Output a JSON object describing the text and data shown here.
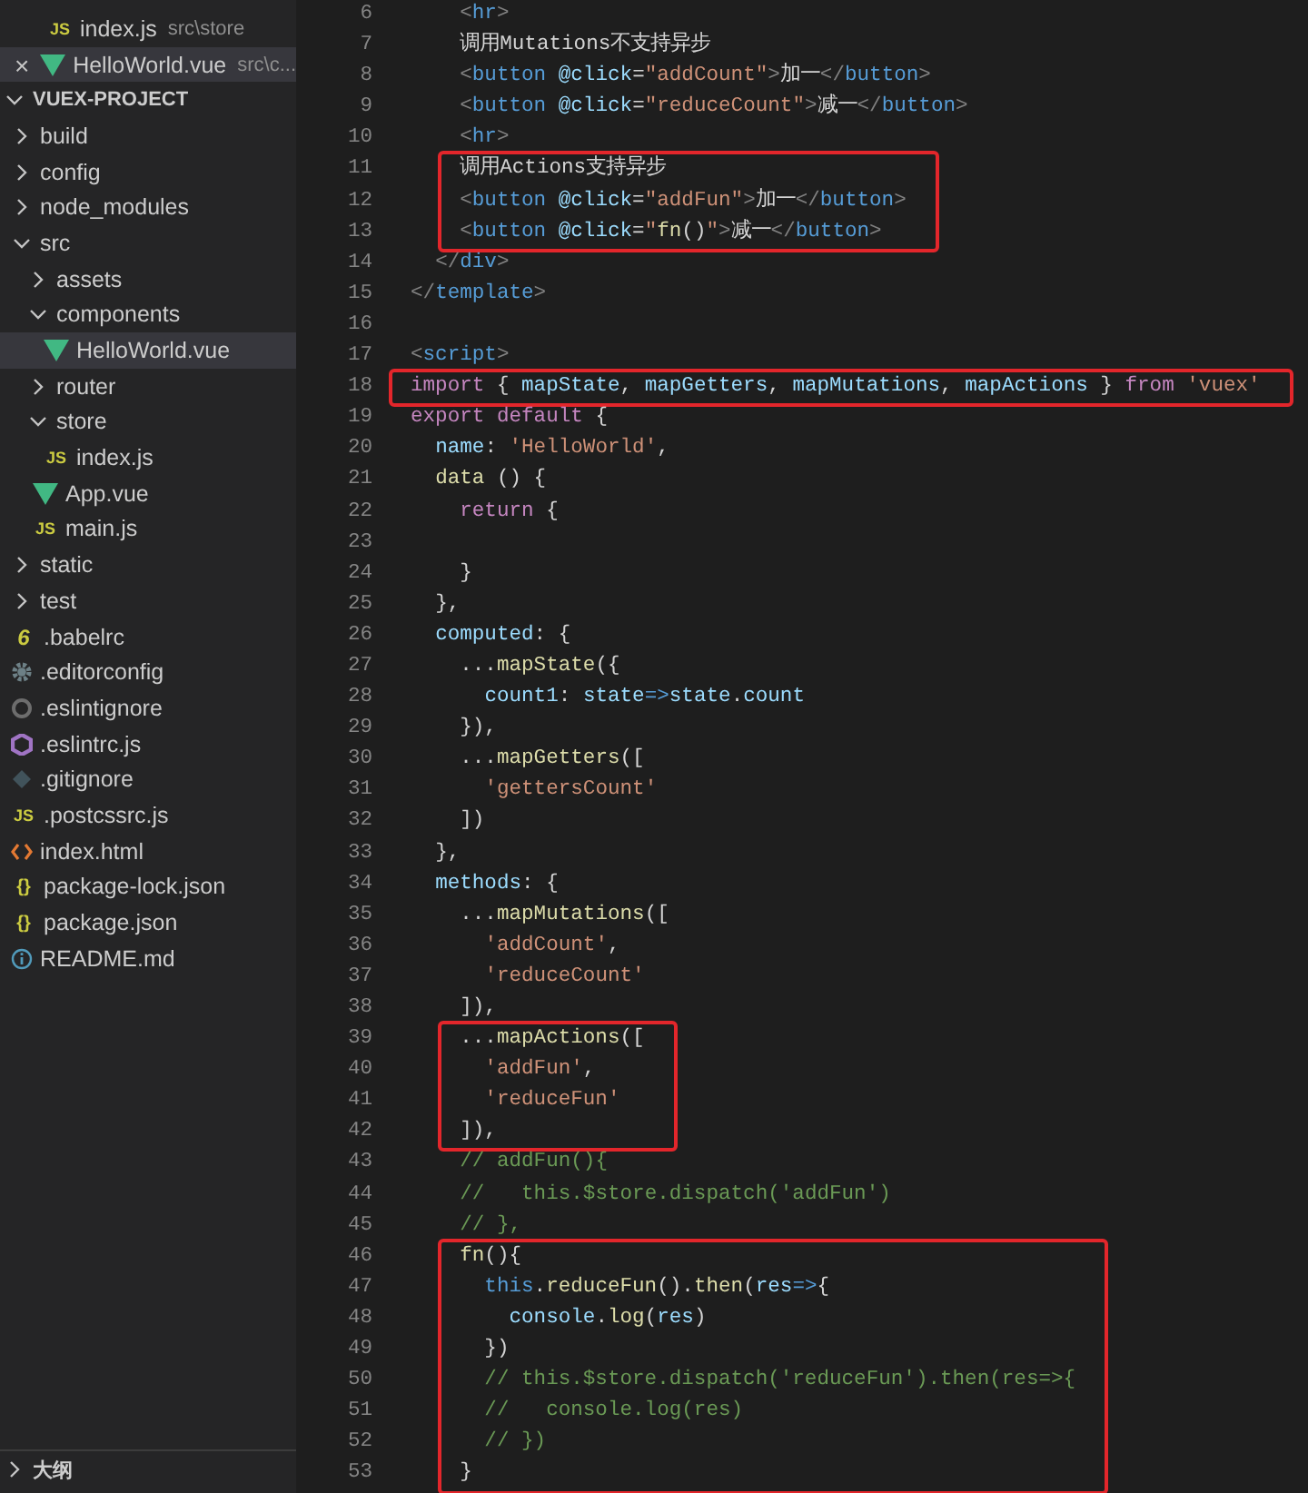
{
  "sidebar": {
    "open_editors": [
      {
        "name": "index.js",
        "path": "src\\store",
        "kind": "js",
        "badge": "JS",
        "selected": false,
        "closable": false
      },
      {
        "name": "HelloWorld.vue",
        "path": "src\\c...",
        "kind": "vue",
        "selected": true,
        "closable": true,
        "close_glyph": "×"
      }
    ],
    "project": {
      "title": "VUEX-PROJECT",
      "expanded": true
    },
    "tree": [
      {
        "kind": "folder",
        "name": "build",
        "expanded": false,
        "selected": false
      },
      {
        "kind": "folder",
        "name": "config",
        "expanded": false,
        "selected": false
      },
      {
        "kind": "folder",
        "name": "node_modules",
        "expanded": false,
        "selected": false
      },
      {
        "kind": "folder",
        "name": "src",
        "expanded": true,
        "selected": false,
        "children": [
          {
            "kind": "folder",
            "name": "assets",
            "expanded": false,
            "selected": false
          },
          {
            "kind": "folder",
            "name": "components",
            "expanded": true,
            "selected": false,
            "children": [
              {
                "kind": "vue",
                "name": "HelloWorld.vue",
                "selected": true
              }
            ]
          },
          {
            "kind": "folder",
            "name": "router",
            "expanded": false,
            "selected": false
          },
          {
            "kind": "folder",
            "name": "store",
            "expanded": true,
            "selected": false,
            "children": [
              {
                "kind": "js",
                "name": "index.js",
                "badge": "JS",
                "selected": false
              }
            ]
          },
          {
            "kind": "vue",
            "name": "App.vue",
            "selected": false
          },
          {
            "kind": "js",
            "name": "main.js",
            "badge": "JS",
            "selected": false
          }
        ]
      },
      {
        "kind": "folder",
        "name": "static",
        "expanded": false,
        "selected": false
      },
      {
        "kind": "folder",
        "name": "test",
        "expanded": false,
        "selected": false
      },
      {
        "kind": "babel",
        "name": ".babelrc",
        "badge": "6",
        "selected": false
      },
      {
        "kind": "gear",
        "name": ".editorconfig",
        "selected": false
      },
      {
        "kind": "ring",
        "name": ".eslintignore",
        "selected": false
      },
      {
        "kind": "hexagon",
        "name": ".eslintrc.js",
        "selected": false
      },
      {
        "kind": "diamond",
        "name": ".gitignore",
        "selected": false
      },
      {
        "kind": "js",
        "name": ".postcssrc.js",
        "badge": "JS",
        "selected": false
      },
      {
        "kind": "html",
        "name": "index.html",
        "selected": false
      },
      {
        "kind": "json",
        "name": "package-lock.json",
        "badge": "{}",
        "selected": false
      },
      {
        "kind": "json",
        "name": "package.json",
        "badge": "{}",
        "selected": false
      },
      {
        "kind": "info",
        "name": "README.md",
        "selected": false
      }
    ],
    "outline": {
      "title": "大纲",
      "expanded": false
    }
  },
  "editor": {
    "blocks": [
      {
        "boxed": false,
        "lines": [
          {
            "n": "6",
            "tokens": [
              {
                "kind": "p",
                "text": "    <"
              },
              {
                "kind": "tag",
                "text": "hr"
              },
              {
                "kind": "p",
                "text": ">"
              }
            ]
          },
          {
            "n": "7",
            "tokens": [
              {
                "kind": "txt",
                "text": "    调用Mutations不支持异步"
              }
            ]
          },
          {
            "n": "8",
            "tokens": [
              {
                "kind": "p",
                "text": "    <"
              },
              {
                "kind": "tag",
                "text": "button"
              },
              {
                "kind": "attr",
                "text": " @click"
              },
              {
                "kind": "txt",
                "text": "="
              },
              {
                "kind": "str",
                "text": "\"addCount\""
              },
              {
                "kind": "p",
                "text": ">"
              },
              {
                "kind": "txt",
                "text": "加一"
              },
              {
                "kind": "p",
                "text": "</"
              },
              {
                "kind": "tag",
                "text": "button"
              },
              {
                "kind": "p",
                "text": ">"
              }
            ]
          },
          {
            "n": "9",
            "tokens": [
              {
                "kind": "p",
                "text": "    <"
              },
              {
                "kind": "tag",
                "text": "button"
              },
              {
                "kind": "attr",
                "text": " @click"
              },
              {
                "kind": "txt",
                "text": "="
              },
              {
                "kind": "str",
                "text": "\"reduceCount\""
              },
              {
                "kind": "p",
                "text": ">"
              },
              {
                "kind": "txt",
                "text": "减一"
              },
              {
                "kind": "p",
                "text": "</"
              },
              {
                "kind": "tag",
                "text": "button"
              },
              {
                "kind": "p",
                "text": ">"
              }
            ]
          },
          {
            "n": "10",
            "tokens": [
              {
                "kind": "p",
                "text": "    <"
              },
              {
                "kind": "tag",
                "text": "hr"
              },
              {
                "kind": "p",
                "text": ">"
              }
            ]
          }
        ]
      },
      {
        "boxed": true,
        "lines": [
          {
            "n": "11",
            "tokens": [
              {
                "kind": "txt",
                "text": "    调用Actions支持异步"
              }
            ]
          },
          {
            "n": "12",
            "tokens": [
              {
                "kind": "p",
                "text": "    <"
              },
              {
                "kind": "tag",
                "text": "button"
              },
              {
                "kind": "attr",
                "text": " @click"
              },
              {
                "kind": "txt",
                "text": "="
              },
              {
                "kind": "str",
                "text": "\"addFun\""
              },
              {
                "kind": "p",
                "text": ">"
              },
              {
                "kind": "txt",
                "text": "加一"
              },
              {
                "kind": "p",
                "text": "</"
              },
              {
                "kind": "tag",
                "text": "button"
              },
              {
                "kind": "p",
                "text": ">"
              }
            ]
          },
          {
            "n": "13",
            "tokens": [
              {
                "kind": "p",
                "text": "    <"
              },
              {
                "kind": "tag",
                "text": "button"
              },
              {
                "kind": "attr",
                "text": " @click"
              },
              {
                "kind": "txt",
                "text": "="
              },
              {
                "kind": "str",
                "text": "\""
              },
              {
                "kind": "fn",
                "text": "fn"
              },
              {
                "kind": "txt",
                "text": "()"
              },
              {
                "kind": "str",
                "text": "\""
              },
              {
                "kind": "p",
                "text": ">"
              },
              {
                "kind": "txt",
                "text": "减一"
              },
              {
                "kind": "p",
                "text": "</"
              },
              {
                "kind": "tag",
                "text": "button"
              },
              {
                "kind": "p",
                "text": ">"
              }
            ]
          }
        ]
      },
      {
        "boxed": false,
        "lines": [
          {
            "n": "14",
            "tokens": [
              {
                "kind": "p",
                "text": "  </"
              },
              {
                "kind": "tag",
                "text": "div"
              },
              {
                "kind": "p",
                "text": ">"
              }
            ]
          },
          {
            "n": "15",
            "tokens": [
              {
                "kind": "p",
                "text": "</"
              },
              {
                "kind": "tag",
                "text": "template"
              },
              {
                "kind": "p",
                "text": ">"
              }
            ]
          },
          {
            "n": "16"
          },
          {
            "n": "17",
            "tokens": [
              {
                "kind": "p",
                "text": "<"
              },
              {
                "kind": "tag",
                "text": "script"
              },
              {
                "kind": "p",
                "text": ">"
              }
            ]
          }
        ]
      },
      {
        "boxed": true,
        "lines": [
          {
            "n": "18",
            "tokens": [
              {
                "kind": "kw",
                "text": "import"
              },
              {
                "kind": "txt",
                "text": " { "
              },
              {
                "kind": "var",
                "text": "mapState"
              },
              {
                "kind": "txt",
                "text": ", "
              },
              {
                "kind": "var",
                "text": "mapGetters"
              },
              {
                "kind": "txt",
                "text": ", "
              },
              {
                "kind": "var",
                "text": "mapMutations"
              },
              {
                "kind": "txt",
                "text": ", "
              },
              {
                "kind": "var",
                "text": "mapActions"
              },
              {
                "kind": "txt",
                "text": " } "
              },
              {
                "kind": "kw",
                "text": "from"
              },
              {
                "kind": "str",
                "text": " 'vuex'"
              }
            ]
          }
        ]
      },
      {
        "boxed": false,
        "lines": [
          {
            "n": "19",
            "tokens": [
              {
                "kind": "kw",
                "text": "export default"
              },
              {
                "kind": "txt",
                "text": " {"
              }
            ]
          },
          {
            "n": "20",
            "tokens": [
              {
                "kind": "var",
                "text": "  name"
              },
              {
                "kind": "txt",
                "text": ": "
              },
              {
                "kind": "str",
                "text": "'HelloWorld'"
              },
              {
                "kind": "txt",
                "text": ","
              }
            ]
          },
          {
            "n": "21",
            "tokens": [
              {
                "kind": "fn",
                "text": "  data"
              },
              {
                "kind": "txt",
                "text": " () {"
              }
            ]
          },
          {
            "n": "22",
            "tokens": [
              {
                "kind": "kw",
                "text": "    return"
              },
              {
                "kind": "txt",
                "text": " {"
              }
            ]
          },
          {
            "n": "23"
          },
          {
            "n": "24",
            "tokens": [
              {
                "kind": "txt",
                "text": "    }"
              }
            ]
          },
          {
            "n": "25",
            "tokens": [
              {
                "kind": "txt",
                "text": "  },"
              }
            ]
          },
          {
            "n": "26",
            "tokens": [
              {
                "kind": "var",
                "text": "  computed"
              },
              {
                "kind": "txt",
                "text": ": {"
              }
            ]
          },
          {
            "n": "27",
            "tokens": [
              {
                "kind": "txt",
                "text": "    ..."
              },
              {
                "kind": "fn",
                "text": "mapState"
              },
              {
                "kind": "txt",
                "text": "({"
              }
            ]
          },
          {
            "n": "28",
            "tokens": [
              {
                "kind": "var",
                "text": "      count1"
              },
              {
                "kind": "txt",
                "text": ": "
              },
              {
                "kind": "var",
                "text": "state"
              },
              {
                "kind": "this",
                "text": "=>"
              },
              {
                "kind": "var",
                "text": "state"
              },
              {
                "kind": "txt",
                "text": "."
              },
              {
                "kind": "var",
                "text": "count"
              }
            ]
          },
          {
            "n": "29",
            "tokens": [
              {
                "kind": "txt",
                "text": "    }),"
              }
            ]
          },
          {
            "n": "30",
            "tokens": [
              {
                "kind": "txt",
                "text": "    ..."
              },
              {
                "kind": "fn",
                "text": "mapGetters"
              },
              {
                "kind": "txt",
                "text": "(["
              }
            ]
          },
          {
            "n": "31",
            "tokens": [
              {
                "kind": "str",
                "text": "      'gettersCount'"
              }
            ]
          },
          {
            "n": "32",
            "tokens": [
              {
                "kind": "txt",
                "text": "    ])"
              }
            ]
          },
          {
            "n": "33",
            "tokens": [
              {
                "kind": "txt",
                "text": "  },"
              }
            ]
          },
          {
            "n": "34",
            "tokens": [
              {
                "kind": "var",
                "text": "  methods"
              },
              {
                "kind": "txt",
                "text": ": {"
              }
            ]
          },
          {
            "n": "35",
            "tokens": [
              {
                "kind": "txt",
                "text": "    ..."
              },
              {
                "kind": "fn",
                "text": "mapMutations"
              },
              {
                "kind": "txt",
                "text": "(["
              }
            ]
          },
          {
            "n": "36",
            "tokens": [
              {
                "kind": "str",
                "text": "      'addCount'"
              },
              {
                "kind": "txt",
                "text": ","
              }
            ]
          },
          {
            "n": "37",
            "tokens": [
              {
                "kind": "str",
                "text": "      'reduceCount'"
              }
            ]
          },
          {
            "n": "38",
            "tokens": [
              {
                "kind": "txt",
                "text": "    ]),"
              }
            ]
          }
        ]
      },
      {
        "boxed": true,
        "lines": [
          {
            "n": "39",
            "tokens": [
              {
                "kind": "txt",
                "text": "    ..."
              },
              {
                "kind": "fn",
                "text": "mapActions"
              },
              {
                "kind": "txt",
                "text": "(["
              }
            ]
          },
          {
            "n": "40",
            "tokens": [
              {
                "kind": "str",
                "text": "      'addFun'"
              },
              {
                "kind": "txt",
                "text": ","
              }
            ]
          },
          {
            "n": "41",
            "tokens": [
              {
                "kind": "str",
                "text": "      'reduceFun'"
              }
            ]
          },
          {
            "n": "42",
            "tokens": [
              {
                "kind": "txt",
                "text": "    ]),"
              }
            ]
          }
        ]
      },
      {
        "boxed": false,
        "lines": [
          {
            "n": "43",
            "tokens": [
              {
                "kind": "cm",
                "text": "    // addFun(){"
              }
            ]
          },
          {
            "n": "44",
            "tokens": [
              {
                "kind": "cm",
                "text": "    //   this.$store.dispatch('addFun')"
              }
            ]
          },
          {
            "n": "45",
            "tokens": [
              {
                "kind": "cm",
                "text": "    // },"
              }
            ]
          }
        ]
      },
      {
        "boxed": true,
        "lines": [
          {
            "n": "46",
            "tokens": [
              {
                "kind": "fn",
                "text": "    fn"
              },
              {
                "kind": "txt",
                "text": "(){"
              }
            ]
          },
          {
            "n": "47",
            "tokens": [
              {
                "kind": "this",
                "text": "      this"
              },
              {
                "kind": "txt",
                "text": "."
              },
              {
                "kind": "fn",
                "text": "reduceFun"
              },
              {
                "kind": "txt",
                "text": "()."
              },
              {
                "kind": "fn",
                "text": "then"
              },
              {
                "kind": "txt",
                "text": "("
              },
              {
                "kind": "var",
                "text": "res"
              },
              {
                "kind": "this",
                "text": "=>"
              },
              {
                "kind": "txt",
                "text": "{"
              }
            ]
          },
          {
            "n": "48",
            "tokens": [
              {
                "kind": "var",
                "text": "        console"
              },
              {
                "kind": "txt",
                "text": "."
              },
              {
                "kind": "fn",
                "text": "log"
              },
              {
                "kind": "txt",
                "text": "("
              },
              {
                "kind": "var",
                "text": "res"
              },
              {
                "kind": "txt",
                "text": ")"
              }
            ]
          },
          {
            "n": "49",
            "tokens": [
              {
                "kind": "txt",
                "text": "      })"
              }
            ]
          },
          {
            "n": "50",
            "tokens": [
              {
                "kind": "cm",
                "text": "      // this.$store.dispatch('reduceFun').then(res=>{"
              }
            ]
          },
          {
            "n": "51",
            "tokens": [
              {
                "kind": "cm",
                "text": "      //   console.log(res)"
              }
            ]
          },
          {
            "n": "52",
            "tokens": [
              {
                "kind": "cm",
                "text": "      // })"
              }
            ]
          },
          {
            "n": "53",
            "tokens": [
              {
                "kind": "txt",
                "text": "    }"
              }
            ]
          }
        ]
      }
    ]
  }
}
